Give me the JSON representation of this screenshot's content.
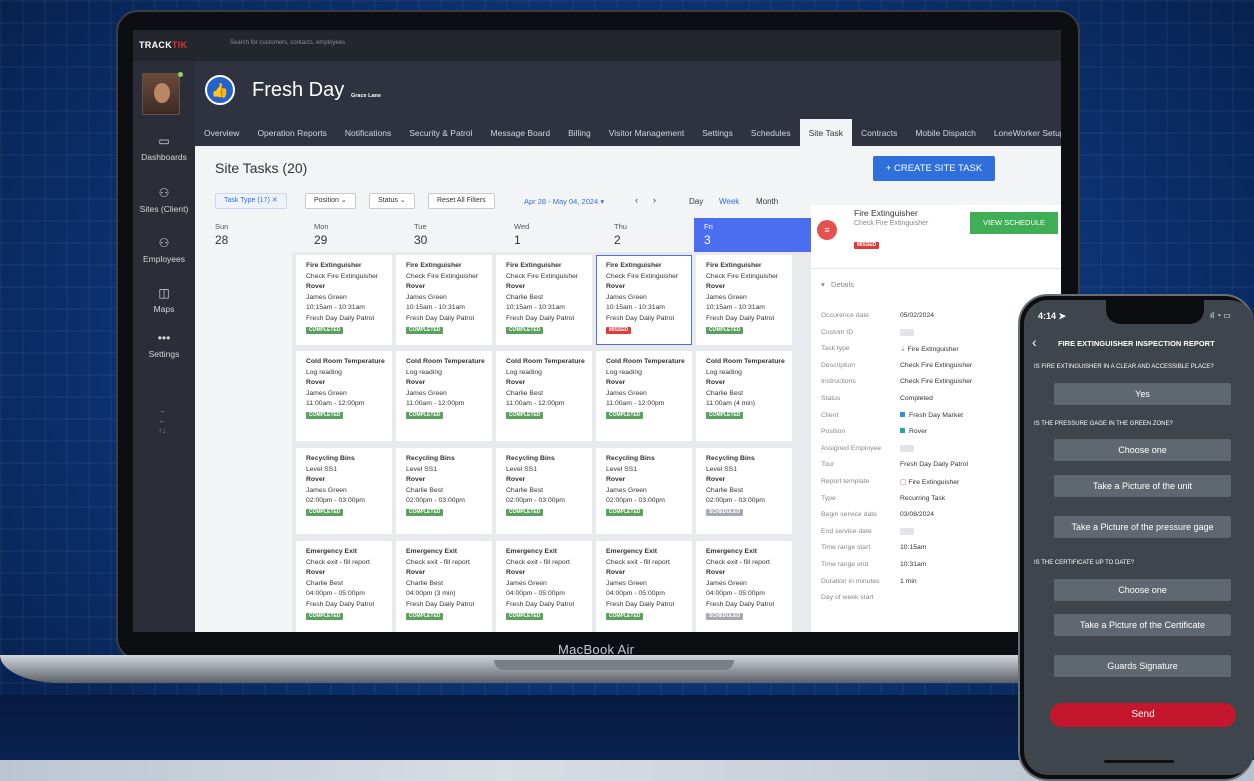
{
  "app": {
    "logo": "TRACKTIK",
    "logo_a": "TRACK",
    "logo_b": "TIK",
    "search_placeholder": "Search for customers, contacts, employees"
  },
  "laptop": {
    "brand": "MacBook Air"
  },
  "sidebar": {
    "items": [
      {
        "label": "Dashboards",
        "icon": "monitor-icon"
      },
      {
        "label": "Sites (Client)",
        "icon": "sites-icon"
      },
      {
        "label": "Employees",
        "icon": "employees-icon"
      },
      {
        "label": "Maps",
        "icon": "map-icon"
      },
      {
        "label": "Settings",
        "icon": "more-icon"
      }
    ]
  },
  "header": {
    "title": "Fresh Day",
    "subtitle": "Grace Lane"
  },
  "tabs": [
    "Overview",
    "Operation Reports",
    "Notifications",
    "Security & Patrol",
    "Message Board",
    "Billing",
    "Visitor Management",
    "Settings",
    "Schedules",
    "Site Task",
    "Contracts",
    "Mobile Dispatch",
    "LoneWorker Setup"
  ],
  "active_tab": "Site Task",
  "page": {
    "title": "Site Tasks (20)",
    "create_label": "+ CREATE SITE TASK"
  },
  "filters": {
    "task_type": "Task Type (17)",
    "position": "Position",
    "status": "Status",
    "reset": "Reset All Filters",
    "date_range": "Apr 28 - May 04, 2024",
    "views": [
      "Day",
      "Week",
      "Month"
    ],
    "active_view": "Week"
  },
  "calendar": {
    "days": [
      {
        "name": "Sun",
        "num": "28"
      },
      {
        "name": "Mon",
        "num": "29"
      },
      {
        "name": "Tue",
        "num": "30"
      },
      {
        "name": "Wed",
        "num": "1"
      },
      {
        "name": "Thu",
        "num": "2"
      },
      {
        "name": "Fri",
        "num": "3"
      }
    ],
    "rows": [
      [
        {
          "title": "Fire Extinguisher",
          "desc": "Check Fire Extinguisher",
          "pos": "Rover",
          "emp": "James Green",
          "time": "10:15am - 10:31am",
          "tour": "Fresh Day Daily Patrol",
          "status": "COMPLETED"
        },
        {
          "title": "Fire Extinguisher",
          "desc": "Check Fire Extinguisher",
          "pos": "Rover",
          "emp": "James Green",
          "time": "10:15am - 10:31am",
          "tour": "Fresh Day Daily Patrol",
          "status": "COMPLETED"
        },
        {
          "title": "Fire Extinguisher",
          "desc": "Check Fire Extinguisher",
          "pos": "Rover",
          "emp": "Charlie Best",
          "time": "10:15am - 10:31am",
          "tour": "Fresh Day Daily Patrol",
          "status": "COMPLETED"
        },
        {
          "title": "Fire Extinguisher",
          "desc": "Check Fire Extinguisher",
          "pos": "Rover",
          "emp": "James Green",
          "time": "10:15am - 10:31am",
          "tour": "Fresh Day Daily Patrol",
          "status": "MISSED"
        },
        {
          "title": "Fire Extinguisher",
          "desc": "Check Fire Extinguisher",
          "pos": "Rover",
          "emp": "James Green",
          "time": "10:15am - 10:31am",
          "tour": "Fresh Day Daily Patrol",
          "status": "COMPLETED"
        }
      ],
      [
        {
          "title": "Cold Room Temperature",
          "desc": "Log reading",
          "pos": "Rover",
          "emp": "James Green",
          "time": "11:00am - 12:00pm",
          "tour": "",
          "status": "COMPLETED"
        },
        {
          "title": "Cold Room Temperature",
          "desc": "Log reading",
          "pos": "Rover",
          "emp": "James Green",
          "time": "11:00am - 12:00pm",
          "tour": "",
          "status": "COMPLETED"
        },
        {
          "title": "Cold Room Temperature",
          "desc": "Log reading",
          "pos": "Rover",
          "emp": "Charlie Best",
          "time": "11:00am - 12:00pm",
          "tour": "",
          "status": "COMPLETED"
        },
        {
          "title": "Cold Room Temperature",
          "desc": "Log reading",
          "pos": "Rover",
          "emp": "James Green",
          "time": "11:00am - 12:00pm",
          "tour": "",
          "status": "COMPLETED"
        },
        {
          "title": "Cold Room Temperature",
          "desc": "Log reading",
          "pos": "Rover",
          "emp": "Charlie Best",
          "time": "11:00am (4 min)",
          "tour": "",
          "status": "COMPLETED"
        }
      ],
      [
        {
          "title": "Recycling Bins",
          "desc": "Level SS1",
          "pos": "Rover",
          "emp": "James Green",
          "time": "02:00pm - 03:00pm",
          "tour": "",
          "status": "COMPLETED"
        },
        {
          "title": "Recycling Bins",
          "desc": "Level SS1",
          "pos": "Rover",
          "emp": "Charlie Best",
          "time": "02:00pm - 03:00pm",
          "tour": "",
          "status": "COMPLETED"
        },
        {
          "title": "Recycling Bins",
          "desc": "Level SS1",
          "pos": "Rover",
          "emp": "Charlie Best",
          "time": "02:00pm - 03:00pm",
          "tour": "",
          "status": "COMPLETED"
        },
        {
          "title": "Recycling Bins",
          "desc": "Level SS1",
          "pos": "Rover",
          "emp": "James Green",
          "time": "02:00pm - 03:00pm",
          "tour": "",
          "status": "COMPLETED"
        },
        {
          "title": "Recycling Bins",
          "desc": "Level SS1",
          "pos": "Rover",
          "emp": "Charlie Best",
          "time": "02:00pm - 03:00pm",
          "tour": "",
          "status": "SCHEDULED"
        }
      ],
      [
        {
          "title": "Emergency Exit",
          "desc": "Check exit - fill report",
          "pos": "Rover",
          "emp": "Charlie Best",
          "time": "04:00pm - 05:00pm",
          "tour": "Fresh Day Daily Patrol",
          "status": "COMPLETED"
        },
        {
          "title": "Emergency Exit",
          "desc": "Check exit - fill report",
          "pos": "Rover",
          "emp": "Charlie Best",
          "time": "04:00pm (3 min)",
          "tour": "Fresh Day Daily Patrol",
          "status": "COMPLETED"
        },
        {
          "title": "Emergency Exit",
          "desc": "Check exit - fill report",
          "pos": "Rover",
          "emp": "James Green",
          "time": "04:00pm - 05:00pm",
          "tour": "Fresh Day Daily Patrol",
          "status": "COMPLETED"
        },
        {
          "title": "Emergency Exit",
          "desc": "Check exit - fill report",
          "pos": "Rover",
          "emp": "James Green",
          "time": "04:00pm - 05:00pm",
          "tour": "Fresh Day Daily Patrol",
          "status": "COMPLETED"
        },
        {
          "title": "Emergency Exit",
          "desc": "Check exit - fill report",
          "pos": "Rover",
          "emp": "James Green",
          "time": "04:00pm - 05:00pm",
          "tour": "Fresh Day Daily Patrol",
          "status": "SCHEDULED"
        }
      ]
    ]
  },
  "detail": {
    "title": "Fire Extinguisher",
    "subtitle": "Check Fire Extinguisher",
    "badge": "MISSED",
    "schedule_button": "VIEW SCHEDULE",
    "section": "Details",
    "fields": [
      {
        "label": "Occurence date",
        "value": "05/02/2024"
      },
      {
        "label": "Custom ID",
        "value": ""
      },
      {
        "label": "Task type",
        "value": "Fire Extinguisher"
      },
      {
        "label": "Description",
        "value": "Check Fire Extinguisher"
      },
      {
        "label": "Instructions",
        "value": "Check Fire Extinguisher"
      },
      {
        "label": "Status",
        "value": "Completed"
      },
      {
        "label": "Client",
        "value": "Fresh Day Market"
      },
      {
        "label": "Position",
        "value": "Rover"
      },
      {
        "label": "Assigned Employee",
        "value": ""
      },
      {
        "label": "Tour",
        "value": "Fresh Day Daily Patrol"
      },
      {
        "label": "Report template",
        "value": "Fire Extinguisher"
      },
      {
        "label": "Type",
        "value": "Recurring Task"
      },
      {
        "label": "Begin service date",
        "value": "03/08/2024"
      },
      {
        "label": "End service date",
        "value": ""
      },
      {
        "label": "Time range start",
        "value": "10:15am"
      },
      {
        "label": "Time range end",
        "value": "10:31am"
      },
      {
        "label": "Duration in minutes",
        "value": "1 min"
      },
      {
        "label": "Day of week start",
        "value": ""
      }
    ]
  },
  "phone": {
    "time": "4:14",
    "report_title": "FIRE EXTINGUISHER INSPECTION REPORT",
    "q1": "IS FIRE EXTINGUISHER IN A CLEAR AND ACCESSIBLE PLACE?",
    "a1": "Yes",
    "q2": "IS THE PRESSURE GAGE IN THE GREEN ZONE?",
    "a2": "Choose one",
    "b_unit": "Take a Picture of the unit",
    "b_gage": "Take a Picture of the pressure gage",
    "q3": "IS THE CERTIFICATE UP TO DATE?",
    "a3": "Choose one",
    "b_cert": "Take a Picture of the Certificate",
    "b_sig": "Guards Signature",
    "send": "Send"
  },
  "colors": {
    "accent": "#2e6fdb",
    "today": "#4b6ef1",
    "completed": "#5aa05f",
    "missed": "#e03b3b",
    "send": "#c4162c"
  }
}
